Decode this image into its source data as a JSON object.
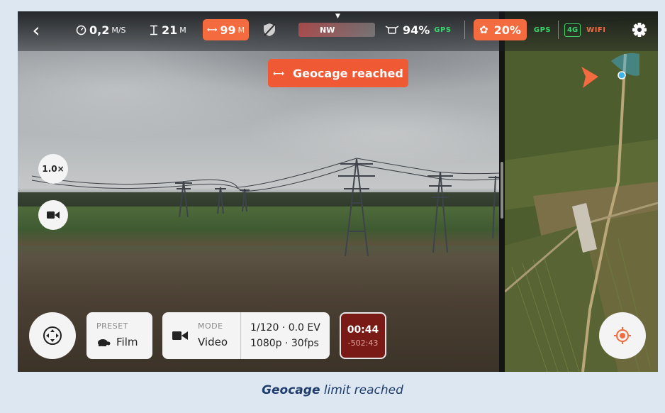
{
  "topbar": {
    "back_label": "‹",
    "speed_value": "0,2",
    "speed_unit": "M/S",
    "altitude_value": "21",
    "altitude_unit": "M",
    "distance_value": "99",
    "distance_unit": "M",
    "compass_label": "NW",
    "drone_battery": "94%",
    "drone_gps_label": "GPS",
    "controller_battery": "20%",
    "controller_gps_label": "GPS",
    "network_4g_label": "4G",
    "wifi_label": "WIFI"
  },
  "alert": {
    "text": "Geocage reached"
  },
  "left_controls": {
    "zoom_label": "1.0×"
  },
  "bottom": {
    "preset_label": "PRESET",
    "preset_value": "Film",
    "mode_label": "MODE",
    "mode_value": "Video",
    "exposure_line": "1/120 · 0.0 EV",
    "format_line": "1080p · 30fps",
    "record_time": "00:44",
    "record_remaining": "-502:43"
  },
  "caption": {
    "bold": "Geocage",
    "rest": " limit reached"
  },
  "colors": {
    "accent": "#f36b3f",
    "alert": "#ef5a35",
    "gps": "#3bd36b",
    "record": "#7a1a16",
    "caption": "#1e3d6c"
  }
}
